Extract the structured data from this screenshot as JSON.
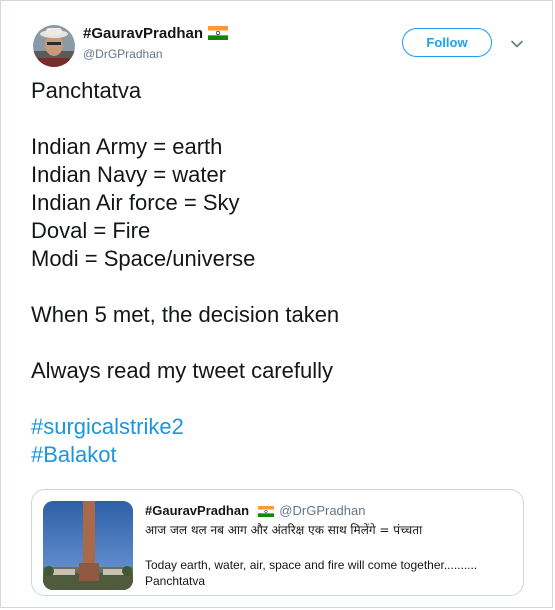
{
  "author": {
    "display_name": "#GauravPradhan",
    "handle": "@DrGPradhan",
    "flag_icon": "india-flag-icon"
  },
  "actions": {
    "follow_label": "Follow",
    "menu_icon": "chevron-down-icon"
  },
  "tweet": {
    "lines": [
      "Panchtatva",
      "",
      "Indian Army = earth",
      "Indian Navy = water",
      "Indian Air force = Sky",
      "Doval = Fire",
      "Modi = Space/universe",
      "",
      "When 5 met, the decision taken",
      "",
      "Always read my tweet carefully",
      ""
    ],
    "hashtags": [
      "#surgicalstrike2",
      "#Balakot"
    ]
  },
  "quoted_tweet": {
    "display_name": "#GauravPradhan",
    "handle": "@DrGPradhan",
    "hindi_text": "आज जल थल नब आग और अंतरिक्ष एक साथ मिलेंगे = पंच्चता",
    "english_text": "Today earth, water, air, space and fire will come together.......... Panchtatva",
    "thumbnail_icon": "war-memorial-thumbnail"
  },
  "colors": {
    "accent": "#1da1f2",
    "hashtag": "#1b95e0",
    "text": "#14171a",
    "secondary": "#657786",
    "border": "#ccd6dd"
  }
}
